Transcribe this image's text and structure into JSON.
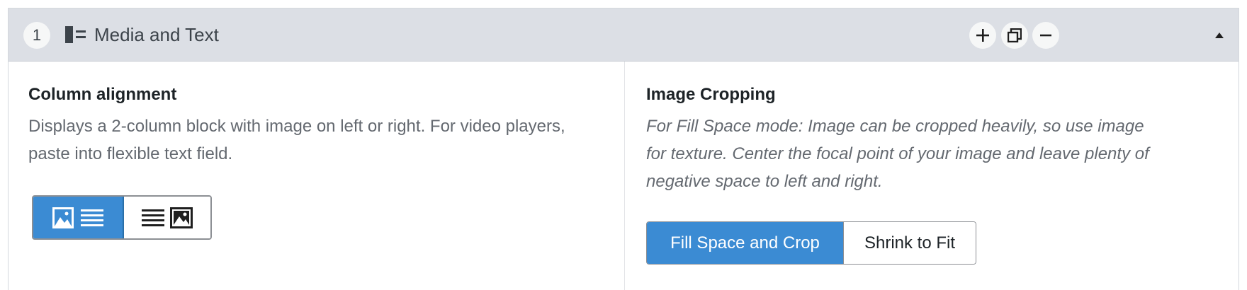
{
  "row": {
    "index": "1",
    "layout_icon": "media-text-layout-icon",
    "title": "Media and Text",
    "actions": [
      {
        "name": "add-row-button",
        "icon": "plus-icon"
      },
      {
        "name": "duplicate-row-button",
        "icon": "duplicate-icon"
      },
      {
        "name": "remove-row-button",
        "icon": "minus-icon"
      },
      {
        "name": "collapse-row-button",
        "icon": "triangle-up-icon"
      }
    ]
  },
  "column_alignment": {
    "label": "Column alignment",
    "description": "Displays a 2-column block with image on left or right. For video players, paste into flexible text field.",
    "options": [
      {
        "name": "image-left",
        "icon": "image-left-text-right-icon",
        "selected": true
      },
      {
        "name": "image-right",
        "icon": "text-left-image-right-icon",
        "selected": false
      }
    ]
  },
  "image_cropping": {
    "label": "Image Cropping",
    "description": "For Fill Space mode: Image can be cropped heavily, so use image for texture. Center the focal point of your image and leave plenty of negative space to left and right.",
    "options": [
      {
        "label": "Fill Space and Crop",
        "selected": true
      },
      {
        "label": "Shrink to Fit",
        "selected": false
      }
    ]
  },
  "colors": {
    "accent": "#3b8bd3",
    "header_bg": "#dcdfe5",
    "description_text": "#646970"
  }
}
